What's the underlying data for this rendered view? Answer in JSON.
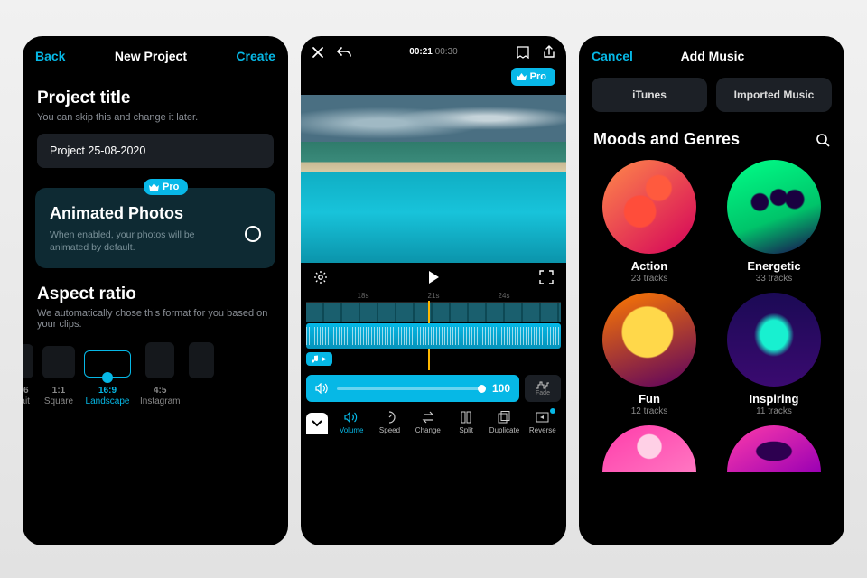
{
  "phone1": {
    "header": {
      "back": "Back",
      "title": "New Project",
      "create": "Create"
    },
    "project_title": {
      "heading": "Project title",
      "sub": "You can skip this and change it later.",
      "value": "Project 25-08-2020"
    },
    "animated": {
      "badge": "Pro",
      "heading": "Animated Photos",
      "sub": "When enabled, your photos will be animated by default."
    },
    "aspect": {
      "heading": "Aspect ratio",
      "sub": "We automatically chose this format for you based on your clips.",
      "items": [
        {
          "ratio": "16",
          "name": "rait"
        },
        {
          "ratio": "1:1",
          "name": "Square"
        },
        {
          "ratio": "16:9",
          "name": "Landscape"
        },
        {
          "ratio": "4:5",
          "name": "Instagram"
        }
      ]
    }
  },
  "phone2": {
    "time": {
      "current": "00:21",
      "total": "00:30"
    },
    "pro": "Pro",
    "marks": [
      "18s",
      "21s",
      "24s"
    ],
    "volume_value": "100",
    "fade": "Fade",
    "tools": [
      "Volume",
      "Speed",
      "Change",
      "Split",
      "Duplicate",
      "Reverse"
    ]
  },
  "phone3": {
    "header": {
      "cancel": "Cancel",
      "title": "Add Music"
    },
    "tabs": [
      "iTunes",
      "Imported Music"
    ],
    "section": "Moods and Genres",
    "moods": [
      {
        "name": "Action",
        "count": "23 tracks"
      },
      {
        "name": "Energetic",
        "count": "33 tracks"
      },
      {
        "name": "Fun",
        "count": "12 tracks"
      },
      {
        "name": "Inspiring",
        "count": "11 tracks"
      }
    ]
  }
}
